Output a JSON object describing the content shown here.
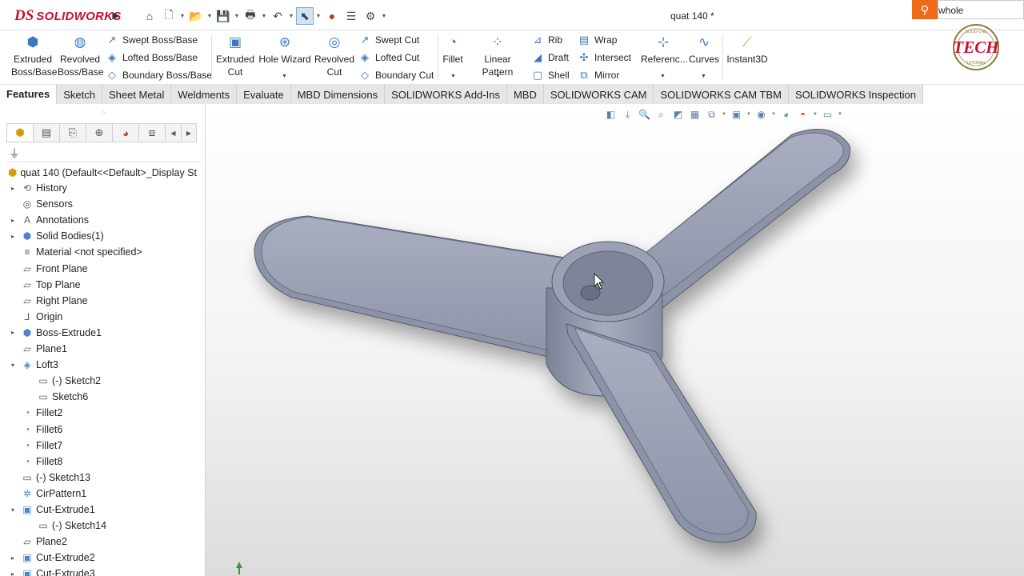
{
  "app": {
    "logo_ds": "DS",
    "logo_text": "SOLIDWORKS",
    "doc_title": "quat 140 *",
    "search_value": "whole"
  },
  "commands": {
    "extruded_boss": "Extruded Boss/Base",
    "revolved_boss": "Revolved Boss/Base",
    "swept_boss": "Swept Boss/Base",
    "lofted_boss": "Lofted Boss/Base",
    "boundary_boss": "Boundary Boss/Base",
    "extruded_cut": "Extruded Cut",
    "hole_wizard": "Hole Wizard",
    "revolved_cut": "Revolved Cut",
    "swept_cut": "Swept Cut",
    "lofted_cut": "Lofted Cut",
    "boundary_cut": "Boundary Cut",
    "fillet": "Fillet",
    "linear_pattern": "Linear Pattern",
    "rib": "Rib",
    "draft": "Draft",
    "shell": "Shell",
    "wrap": "Wrap",
    "intersect": "Intersect",
    "mirror": "Mirror",
    "reference": "Referenc...",
    "curves": "Curves",
    "instant3d": "Instant3D"
  },
  "tabs": [
    {
      "label": "Features",
      "active": true
    },
    {
      "label": "Sketch"
    },
    {
      "label": "Sheet Metal"
    },
    {
      "label": "Weldments"
    },
    {
      "label": "Evaluate"
    },
    {
      "label": "MBD Dimensions"
    },
    {
      "label": "SOLIDWORKS Add-Ins"
    },
    {
      "label": "MBD"
    },
    {
      "label": "SOLIDWORKS CAM"
    },
    {
      "label": "SOLIDWORKS CAM TBM"
    },
    {
      "label": "SOLIDWORKS Inspection"
    }
  ],
  "tree": {
    "root": "quat 140  (Default<<Default>_Display St",
    "items": [
      {
        "label": "History",
        "icon": "history-icon",
        "expander": "▸",
        "indent": 0
      },
      {
        "label": "Sensors",
        "icon": "sensor-icon",
        "expander": "",
        "indent": 0
      },
      {
        "label": "Annotations",
        "icon": "annotation-icon",
        "expander": "▸",
        "indent": 0
      },
      {
        "label": "Solid Bodies(1)",
        "icon": "solid-bodies-icon",
        "expander": "▸",
        "indent": 0
      },
      {
        "label": "Material <not specified>",
        "icon": "material-icon",
        "expander": "",
        "indent": 0
      },
      {
        "label": "Front Plane",
        "icon": "plane-icon",
        "expander": "",
        "indent": 0
      },
      {
        "label": "Top Plane",
        "icon": "plane-icon",
        "expander": "",
        "indent": 0
      },
      {
        "label": "Right Plane",
        "icon": "plane-icon",
        "expander": "",
        "indent": 0
      },
      {
        "label": "Origin",
        "icon": "origin-icon",
        "expander": "",
        "indent": 0
      },
      {
        "label": "Boss-Extrude1",
        "icon": "extrude-icon",
        "expander": "▸",
        "indent": 0
      },
      {
        "label": "Plane1",
        "icon": "plane-icon",
        "expander": "",
        "indent": 0
      },
      {
        "label": "Loft3",
        "icon": "loft-icon",
        "expander": "▾",
        "indent": 0
      },
      {
        "label": "(-) Sketch2",
        "icon": "sketch-icon",
        "expander": "",
        "indent": 1
      },
      {
        "label": "Sketch6",
        "icon": "sketch-icon",
        "expander": "",
        "indent": 1
      },
      {
        "label": "Fillet2",
        "icon": "fillet-icon",
        "expander": "",
        "indent": 0
      },
      {
        "label": "Fillet6",
        "icon": "fillet-icon",
        "expander": "",
        "indent": 0
      },
      {
        "label": "Fillet7",
        "icon": "fillet-icon",
        "expander": "",
        "indent": 0
      },
      {
        "label": "Fillet8",
        "icon": "fillet-icon",
        "expander": "",
        "indent": 0
      },
      {
        "label": "(-) Sketch13",
        "icon": "sketch-icon",
        "expander": "",
        "indent": 0
      },
      {
        "label": "CirPattern1",
        "icon": "circular-pattern-icon",
        "expander": "",
        "indent": 0
      },
      {
        "label": "Cut-Extrude1",
        "icon": "cut-extrude-icon",
        "expander": "▾",
        "indent": 0
      },
      {
        "label": "(-) Sketch14",
        "icon": "sketch-icon",
        "expander": "",
        "indent": 1
      },
      {
        "label": "Plane2",
        "icon": "plane-icon",
        "expander": "",
        "indent": 0
      },
      {
        "label": "Cut-Extrude2",
        "icon": "cut-extrude-icon",
        "expander": "▸",
        "indent": 0
      },
      {
        "label": "Cut-Extrude3",
        "icon": "cut-extrude-icon",
        "expander": "▸",
        "indent": 0
      }
    ]
  },
  "watermark": {
    "main": "TECH",
    "top": "SOLID-CAE",
    "bottom": "TUTORIAL"
  },
  "colors": {
    "brand_red": "#c8102e",
    "search_orange": "#f06a1c",
    "model_face": "#9ea4b6",
    "accent_blue": "#3c78c0"
  }
}
